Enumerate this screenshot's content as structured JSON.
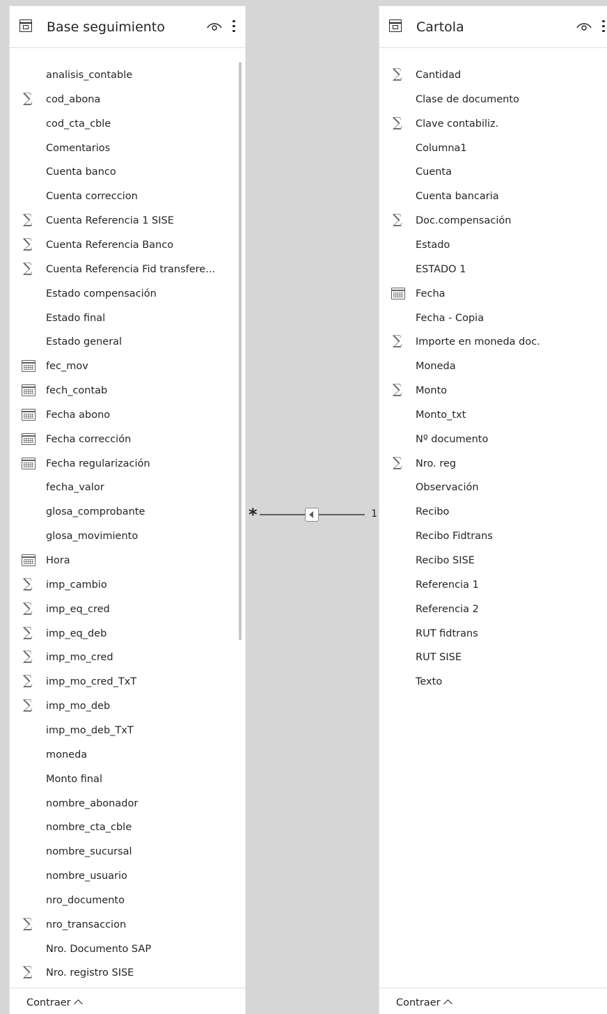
{
  "left_table": {
    "title": "Base seguimiento",
    "fields": [
      {
        "name": "analisis_contable",
        "icon": null
      },
      {
        "name": "cod_abona",
        "icon": "sigma-icon"
      },
      {
        "name": "cod_cta_cble",
        "icon": null
      },
      {
        "name": "Comentarios",
        "icon": null
      },
      {
        "name": "Cuenta banco",
        "icon": null
      },
      {
        "name": "Cuenta correccion",
        "icon": null
      },
      {
        "name": "Cuenta Referencia 1 SISE",
        "icon": "sigma-icon"
      },
      {
        "name": "Cuenta Referencia Banco",
        "icon": "sigma-icon"
      },
      {
        "name": "Cuenta Referencia Fid transfere...",
        "icon": "sigma-icon"
      },
      {
        "name": "Estado compensación",
        "icon": null
      },
      {
        "name": "Estado final",
        "icon": null
      },
      {
        "name": "Estado general",
        "icon": null
      },
      {
        "name": "fec_mov",
        "icon": "calendar-icon"
      },
      {
        "name": "fech_contab",
        "icon": "calendar-icon"
      },
      {
        "name": "Fecha abono",
        "icon": "calendar-icon"
      },
      {
        "name": "Fecha corrección",
        "icon": "calendar-icon"
      },
      {
        "name": "Fecha regularización",
        "icon": "calendar-icon"
      },
      {
        "name": "fecha_valor",
        "icon": null
      },
      {
        "name": "glosa_comprobante",
        "icon": null
      },
      {
        "name": "glosa_movimiento",
        "icon": null
      },
      {
        "name": "Hora",
        "icon": "calendar-icon"
      },
      {
        "name": "imp_cambio",
        "icon": "sigma-icon"
      },
      {
        "name": "imp_eq_cred",
        "icon": "sigma-icon"
      },
      {
        "name": "imp_eq_deb",
        "icon": "sigma-icon"
      },
      {
        "name": "imp_mo_cred",
        "icon": "sigma-icon"
      },
      {
        "name": "imp_mo_cred_TxT",
        "icon": "sigma-icon"
      },
      {
        "name": "imp_mo_deb",
        "icon": "sigma-icon"
      },
      {
        "name": "imp_mo_deb_TxT",
        "icon": null
      },
      {
        "name": "moneda",
        "icon": null
      },
      {
        "name": "Monto final",
        "icon": null
      },
      {
        "name": "nombre_abonador",
        "icon": null
      },
      {
        "name": "nombre_cta_cble",
        "icon": null
      },
      {
        "name": "nombre_sucursal",
        "icon": null
      },
      {
        "name": "nombre_usuario",
        "icon": null
      },
      {
        "name": "nro_documento",
        "icon": null
      },
      {
        "name": "nro_transaccion",
        "icon": "sigma-icon"
      },
      {
        "name": "Nro. Documento SAP",
        "icon": null
      },
      {
        "name": "Nro. registro SISE",
        "icon": "sigma-icon"
      }
    ],
    "footer_label": "Contraer"
  },
  "right_table": {
    "title": "Cartola",
    "fields": [
      {
        "name": "Cantidad",
        "icon": "sigma-icon"
      },
      {
        "name": "Clase de documento",
        "icon": null
      },
      {
        "name": "Clave contabiliz.",
        "icon": "sigma-icon"
      },
      {
        "name": "Columna1",
        "icon": null
      },
      {
        "name": "Cuenta",
        "icon": null
      },
      {
        "name": "Cuenta bancaria",
        "icon": null
      },
      {
        "name": "Doc.compensación",
        "icon": "sigma-icon"
      },
      {
        "name": "Estado",
        "icon": null
      },
      {
        "name": "ESTADO 1",
        "icon": null
      },
      {
        "name": "Fecha",
        "icon": "calendar-icon"
      },
      {
        "name": "Fecha - Copia",
        "icon": null
      },
      {
        "name": "Importe en moneda doc.",
        "icon": "sigma-icon"
      },
      {
        "name": "Moneda",
        "icon": null
      },
      {
        "name": "Monto",
        "icon": "sigma-icon"
      },
      {
        "name": "Monto_txt",
        "icon": null
      },
      {
        "name": "Nº documento",
        "icon": null
      },
      {
        "name": "Nro. reg",
        "icon": "sigma-icon"
      },
      {
        "name": "Observación",
        "icon": null
      },
      {
        "name": "Recibo",
        "icon": null
      },
      {
        "name": "Recibo Fidtrans",
        "icon": null
      },
      {
        "name": "Recibo SISE",
        "icon": null
      },
      {
        "name": "Referencia 1",
        "icon": null
      },
      {
        "name": "Referencia 2",
        "icon": null
      },
      {
        "name": "RUT fidtrans",
        "icon": null
      },
      {
        "name": "RUT SISE",
        "icon": null
      },
      {
        "name": "Texto",
        "icon": null
      }
    ],
    "footer_label": "Contraer"
  },
  "relationship": {
    "from_cardinality": "*",
    "to_cardinality": "1"
  }
}
